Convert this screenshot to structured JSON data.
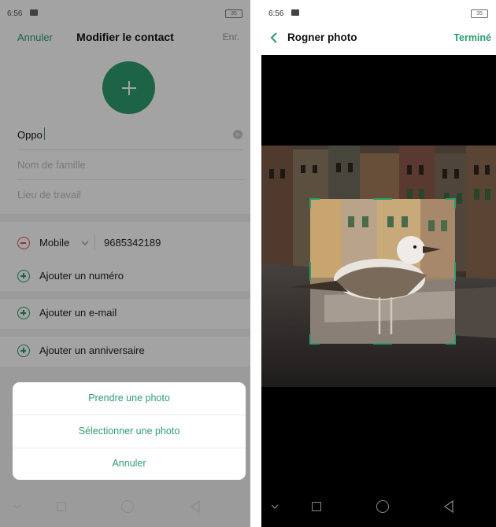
{
  "left_screen": {
    "status": {
      "time": "6:56",
      "battery": "35"
    },
    "header": {
      "cancel": "Annuler",
      "title": "Modifier le contact",
      "save": "Enr."
    },
    "fields": {
      "first_name": "Oppo",
      "last_name_placeholder": "Nom de famille",
      "company_placeholder": "Lieu de travail"
    },
    "phone_row": {
      "type": "Mobile",
      "number": "9685342189"
    },
    "add_rows": [
      "Ajouter un numéro",
      "Ajouter un e-mail",
      "Ajouter un anniversaire"
    ],
    "sheet": {
      "take_photo": "Prendre une photo",
      "select_photo": "Sélectionner une photo",
      "cancel": "Annuler"
    }
  },
  "right_screen": {
    "status": {
      "time": "6:56",
      "battery": "35"
    },
    "header": {
      "title": "Rogner photo",
      "done": "Terminé"
    }
  },
  "colors": {
    "accent": "#2e9c6c",
    "danger": "#d9534f"
  },
  "icons": [
    "plus-icon",
    "clear-icon",
    "minus-circle-icon",
    "plus-circle-icon",
    "chevron-down-icon",
    "back-chevron-icon",
    "nav-back-icon",
    "nav-home-icon",
    "nav-recents-icon"
  ]
}
